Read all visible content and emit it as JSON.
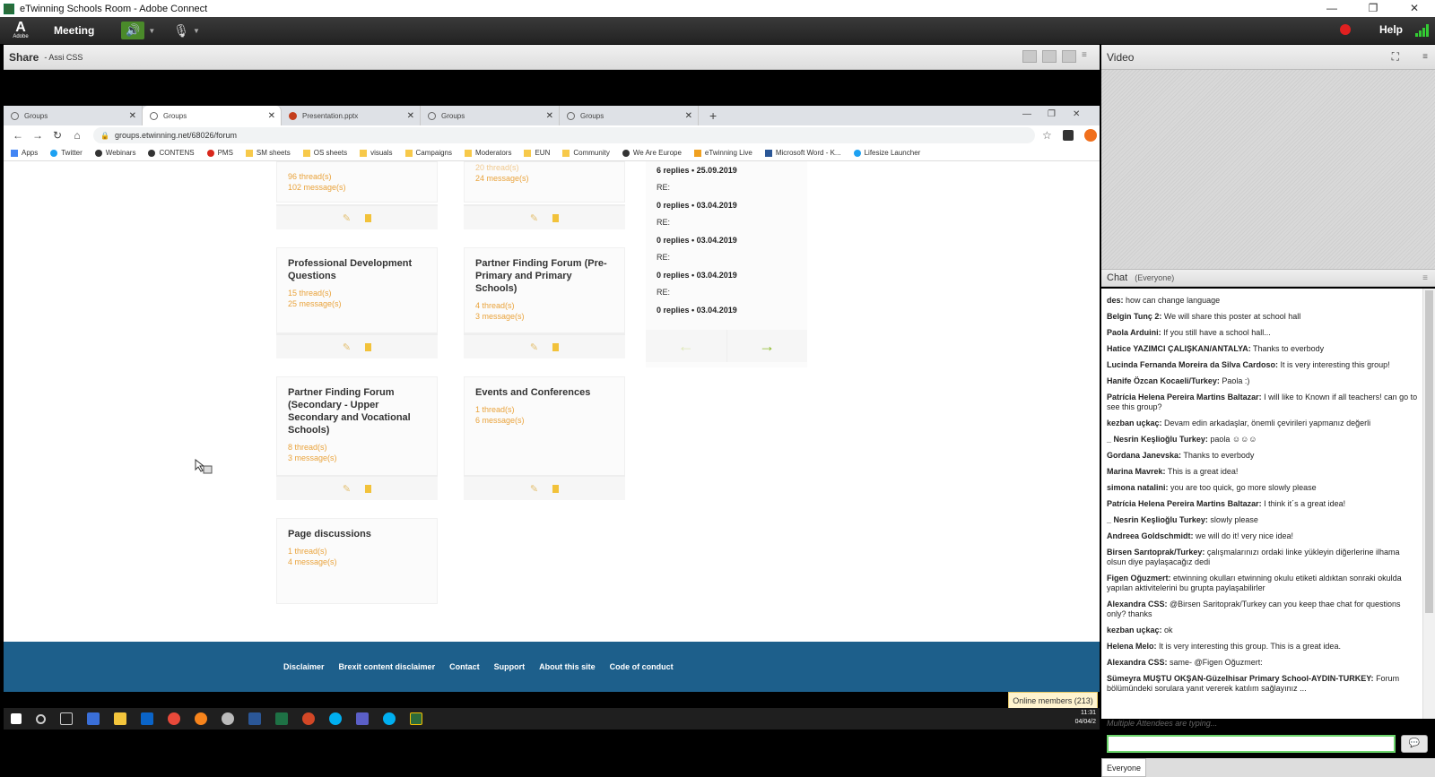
{
  "window": {
    "title": "eTwinning Schools Room - Adobe Connect",
    "min": "—",
    "max": "❐",
    "close": "✕"
  },
  "menubar": {
    "adobe": "A",
    "adobe_sub": "Adobe",
    "meeting": "Meeting",
    "help": "Help"
  },
  "share": {
    "label": "Share",
    "sub": "- Assi CSS"
  },
  "browser": {
    "tabs": [
      {
        "label": "Groups"
      },
      {
        "label": "Groups"
      },
      {
        "label": "Presentation.pptx"
      },
      {
        "label": "Groups"
      },
      {
        "label": "Groups"
      }
    ],
    "url": "groups.etwinning.net/68026/forum",
    "bookmarks": [
      "Apps",
      "Twitter",
      "Webinars",
      "CONTENS",
      "PMS",
      "SM sheets",
      "OS sheets",
      "visuals",
      "Campaigns",
      "Moderators",
      "EUN",
      "Community",
      "We Are Europe",
      "eTwinning Live",
      "Microsoft Word - K...",
      "Lifesize Launcher"
    ]
  },
  "forums": {
    "top_left": {
      "threads": "96 thread(s)",
      "messages": "102 message(s)"
    },
    "top_mid": {
      "threads": "20 thread(s)",
      "messages": "24 message(s)"
    },
    "pd": {
      "title": "Professional Development Questions",
      "threads": "15 thread(s)",
      "messages": "25 message(s)"
    },
    "pf_primary": {
      "title": "Partner Finding Forum (Pre- Primary and Primary Schools)",
      "threads": "4 thread(s)",
      "messages": "3 message(s)"
    },
    "pf_secondary": {
      "title": "Partner Finding Forum (Secondary - Upper Secondary and Vocational Schools)",
      "threads": "8 thread(s)",
      "messages": "3 message(s)"
    },
    "events": {
      "title": "Events and Conferences",
      "threads": "1 thread(s)",
      "messages": "6 message(s)"
    },
    "page_disc": {
      "title": "Page discussions",
      "threads": "1 thread(s)",
      "messages": "4 message(s)"
    }
  },
  "latest": {
    "first": "6 replies • 25.09.2019",
    "items": [
      {
        "re": "RE:",
        "meta": "0 replies • 03.04.2019"
      },
      {
        "re": "RE:",
        "meta": "0 replies • 03.04.2019"
      },
      {
        "re": "RE:",
        "meta": "0 replies • 03.04.2019"
      },
      {
        "re": "RE:",
        "meta": "0 replies • 03.04.2019"
      }
    ],
    "prev": "←",
    "next": "→"
  },
  "footer": [
    "Disclaimer",
    "Brexit content disclaimer",
    "Contact",
    "Support",
    "About this site",
    "Code of conduct"
  ],
  "online_members": "Online members (213)",
  "taskbar": {
    "time": "11:31",
    "date": "04/04/2"
  },
  "video": {
    "label": "Video"
  },
  "chat": {
    "label": "Chat",
    "scope": "(Everyone)",
    "messages": [
      {
        "name": "des:",
        "text": " how can change language"
      },
      {
        "name": "Belgin Tunç 2:",
        "text": " We will share this poster at school hall"
      },
      {
        "name": "Paola Arduini:",
        "text": " If you still have a school hall..."
      },
      {
        "name": "Hatice YAZIMCI ÇALIŞKAN/ANTALYA:",
        "text": " Thanks to everbody"
      },
      {
        "name": "Lucinda Fernanda Moreira da Silva Cardoso:",
        "text": " It is very interesting this group!"
      },
      {
        "name": "Hanife Özcan Kocaeli/Turkey:",
        "text": " Paola :)"
      },
      {
        "name": "Patrícia Helena Pereira Martins Baltazar:",
        "text": " I will like to Known if all teachers! can go to see this group?"
      },
      {
        "name": "kezban uçkaç:",
        "text": " Devam edin arkadaşlar, önemli çevirileri yapmanız değerli"
      },
      {
        "name": "_ Nesrin Keşlioğlu Turkey:",
        "text": " paola ☺☺☺"
      },
      {
        "name": "Gordana Janevska:",
        "text": " Thanks to everbody"
      },
      {
        "name": "Marina Mavrek:",
        "text": " This is a great idea!"
      },
      {
        "name": "simona natalini:",
        "text": " you are too quick, go more slowly please"
      },
      {
        "name": "Patrícia Helena Pereira Martins Baltazar:",
        "text": " I think it´s a great idea!"
      },
      {
        "name": "_ Nesrin Keşlioğlu Turkey:",
        "text": " slowly please"
      },
      {
        "name": "Andreea Goldschmidt:",
        "text": " we will do it! very nice idea!"
      },
      {
        "name": "Birsen Sarıtoprak/Turkey:",
        "text": " çalışmalarınızı ordaki linke yükleyin diğerlerine ilhama olsun diye paylaşacağız dedi"
      },
      {
        "name": "Figen Oğuzmert:",
        "text": " etwinning okulları etwinning okulu etiketi aldıktan sonraki okulda yapılan aktivitelerini bu grupta paylaşabilirler"
      },
      {
        "name": "Alexandra CSS:",
        "text": " @Birsen Saritoprak/Turkey can you keep thae chat for questions only? thanks"
      },
      {
        "name": "kezban uçkaç:",
        "text": " ok"
      },
      {
        "name": "Helena Melo:",
        "text": " It is very interesting this group. This is a great idea."
      },
      {
        "name": "Alexandra CSS:",
        "text": " same- @Figen Oğuzmert:"
      },
      {
        "name": "Sümeyra MUŞTU OKŞAN-Güzelhisar Primary School-AYDIN-TURKEY:",
        "text": " Forum bölümündeki sorulara yanıt vererek katılım sağlayınız ..."
      }
    ],
    "typing": "Multiple Attendees are typing...",
    "tab_everyone": "Everyone"
  }
}
